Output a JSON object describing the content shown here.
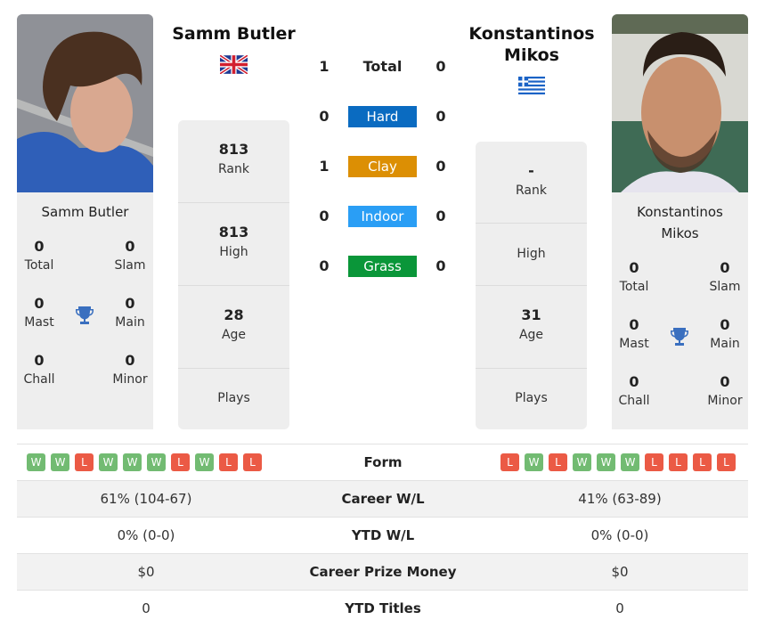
{
  "player1": {
    "name": "Samm Butler",
    "country": "Great Britain",
    "flag_icon": "uk-flag-icon",
    "titles": {
      "total": "0",
      "slam": "0",
      "mast": "0",
      "main": "0",
      "chall": "0",
      "minor": "0"
    },
    "stats": {
      "rank": "813",
      "high": "813",
      "age": "28",
      "plays": ""
    },
    "h2h": {
      "total": "1",
      "hard": "0",
      "clay": "1",
      "indoor": "0",
      "grass": "0"
    },
    "form": [
      "W",
      "W",
      "L",
      "W",
      "W",
      "W",
      "L",
      "W",
      "L",
      "L"
    ],
    "career_wl": "61% (104-67)",
    "ytd_wl": "0% (0-0)",
    "career_prize": "$0",
    "ytd_titles": "0"
  },
  "player2": {
    "name": "Konstantinos Mikos",
    "name_line1": "Konstantinos",
    "name_line2": "Mikos",
    "country": "Greece",
    "flag_icon": "greece-flag-icon",
    "titles": {
      "total": "0",
      "slam": "0",
      "mast": "0",
      "main": "0",
      "chall": "0",
      "minor": "0"
    },
    "stats": {
      "rank": "-",
      "high": "",
      "age": "31",
      "plays": ""
    },
    "h2h": {
      "total": "0",
      "hard": "0",
      "clay": "0",
      "indoor": "0",
      "grass": "0"
    },
    "form": [
      "L",
      "W",
      "L",
      "W",
      "W",
      "W",
      "L",
      "L",
      "L",
      "L"
    ],
    "career_wl": "41% (63-89)",
    "ytd_wl": "0% (0-0)",
    "career_prize": "$0",
    "ytd_titles": "0"
  },
  "labels": {
    "total": "Total",
    "slam": "Slam",
    "mast": "Mast",
    "main": "Main",
    "chall": "Chall",
    "minor": "Minor",
    "rank": "Rank",
    "high": "High",
    "age": "Age",
    "plays": "Plays",
    "h2h_total": "Total",
    "form": "Form",
    "career_wl": "Career W/L",
    "ytd_wl": "YTD W/L",
    "career_prize": "Career Prize Money",
    "ytd_titles": "YTD Titles"
  },
  "surfaces": [
    {
      "key": "hard",
      "label": "Hard",
      "color": "#0a6bc1"
    },
    {
      "key": "clay",
      "label": "Clay",
      "color": "#dc8f04"
    },
    {
      "key": "indoor",
      "label": "Indoor",
      "color": "#2a9ef5"
    },
    {
      "key": "grass",
      "label": "Grass",
      "color": "#0a9639"
    }
  ],
  "colors": {
    "win": "#72bb72",
    "loss": "#eb5a45",
    "trophy": "#3a6fbf",
    "card_bg": "#eeeeee"
  }
}
